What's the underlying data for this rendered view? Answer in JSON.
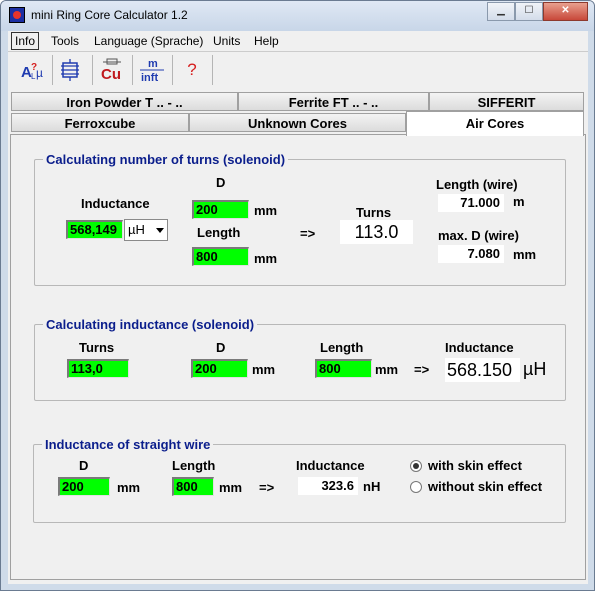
{
  "window": {
    "title": "mini Ring Core Calculator 1.2"
  },
  "menu": [
    "Info",
    "Tools",
    "Language (Sprache)",
    "Units",
    "Help"
  ],
  "toolbar": {
    "cu_label": "Cu",
    "minft_top": "m",
    "minft_bottom": "inft",
    "help_label": "?"
  },
  "tabs": {
    "row1": [
      "Iron Powder T .. - ..",
      "Ferrite FT .. - ..",
      "SIFFERIT"
    ],
    "row2": [
      "Ferroxcube",
      "Unknown Cores",
      "Air Cores"
    ],
    "active": "Air Cores"
  },
  "turns_group": {
    "title": "Calculating number of turns (solenoid)",
    "inductance_label": "Inductance",
    "inductance_value": "568,149",
    "inductance_unit": "µH",
    "d_label": "D",
    "d_value": "200",
    "d_unit": "mm",
    "length_label": "Length",
    "length_value": "800",
    "length_unit": "mm",
    "arrow": "=>",
    "turns_label": "Turns",
    "turns_value": "113.0",
    "wire_length_label": "Length (wire)",
    "wire_length_value": "71.000",
    "wire_length_unit": "m",
    "maxd_label": "max. D (wire)",
    "maxd_value": "7.080",
    "maxd_unit": "mm"
  },
  "inductance_group": {
    "title": "Calculating inductance (solenoid)",
    "turns_label": "Turns",
    "turns_value": "113,0",
    "d_label": "D",
    "d_value": "200",
    "d_unit": "mm",
    "length_label": "Length",
    "length_value": "800",
    "length_unit": "mm",
    "arrow": "=>",
    "inductance_label": "Inductance",
    "inductance_value": "568.150",
    "inductance_unit": "µH"
  },
  "wire_group": {
    "title": "Inductance of straight wire",
    "d_label": "D",
    "d_value": "200",
    "d_unit": "mm",
    "length_label": "Length",
    "length_value": "800",
    "length_unit": "mm",
    "arrow": "=>",
    "inductance_label": "Inductance",
    "inductance_value": "323.6",
    "inductance_unit": "nH",
    "option_skin": "with skin effect",
    "option_no_skin": "without skin effect",
    "selected": "with skin effect"
  }
}
